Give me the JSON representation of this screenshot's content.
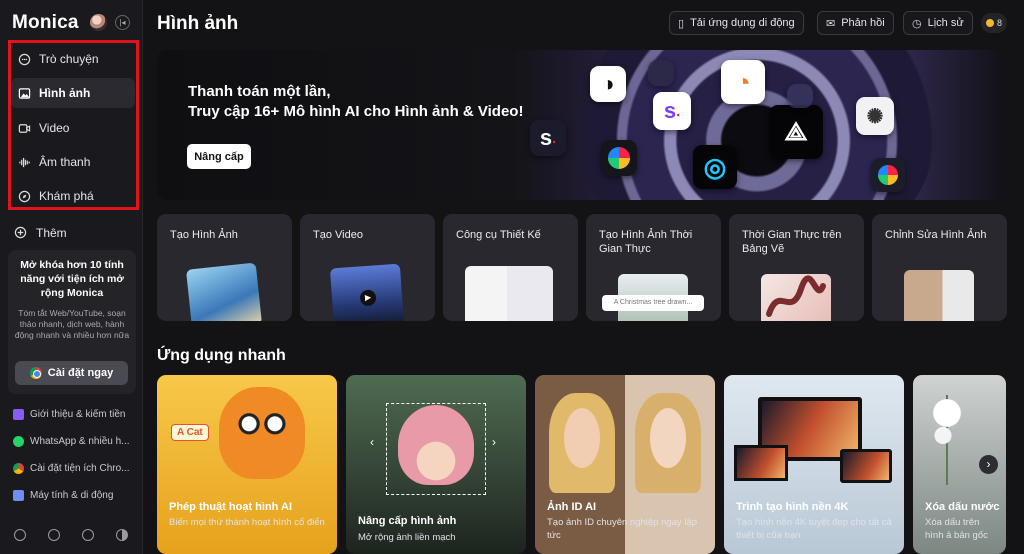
{
  "sidebar": {
    "brand": "Monica",
    "nav": [
      {
        "label": "Trò chuyện",
        "icon": "chat-bubble-icon"
      },
      {
        "label": "Hình ảnh",
        "icon": "image-icon"
      },
      {
        "label": "Video",
        "icon": "video-icon"
      },
      {
        "label": "Âm thanh",
        "icon": "audio-wave-icon"
      },
      {
        "label": "Khám phá",
        "icon": "compass-icon"
      }
    ],
    "more": "Thêm",
    "promo": {
      "title": "Mở khóa hơn 10 tính năng với tiện ích mở rộng Monica",
      "desc": "Tóm tắt Web/YouTube, soạn thảo nhanh, dịch web, hành động nhanh và nhiều hơn nữa",
      "button": "Cài đặt ngay"
    },
    "links": [
      "Giới thiệu & kiếm tiền",
      "WhatsApp & nhiều h...",
      "Cài đặt tiện ích Chro...",
      "Máy tính & di động"
    ]
  },
  "header": {
    "title": "Hình ảnh",
    "buttons": [
      "Tải ứng dụng di động",
      "Phản hồi",
      "Lịch sử"
    ],
    "credits": "8"
  },
  "banner": {
    "line1": "Thanh toán một lần,",
    "line2": "Truy cập 16+ Mô hình AI cho Hình ảnh & Video!",
    "button": "Nâng cấp"
  },
  "features": [
    "Tạo Hình Ảnh",
    "Tạo Video",
    "Công cụ Thiết Kế",
    "Tạo Hình Ảnh Thời Gian Thực",
    "Thời Gian Thực trên Bảng Vẽ",
    "Chỉnh Sửa Hình Ảnh"
  ],
  "feature_caption": "A Christmas tree drawn...",
  "quick_title": "Ứng dụng nhanh",
  "quick_apps": [
    {
      "title": "Phép thuật hoạt hình AI",
      "desc": "Biến mọi thứ thành hoạt hình cổ điển",
      "tag": "A Cat"
    },
    {
      "title": "Nâng cấp hình ảnh",
      "desc": "Mở rộng ảnh liền mạch"
    },
    {
      "title": "Ảnh ID AI",
      "desc": "Tạo ảnh ID chuyên nghiệp ngay lập tức"
    },
    {
      "title": "Trình tạo hình nền 4K",
      "desc": "Tạo hình nền 4K tuyệt đẹp cho tất cả thiết bị của bạn"
    },
    {
      "title": "Xóa dấu nước",
      "desc": "Xóa dấu trên hình ả bản gốc"
    }
  ],
  "colors": {
    "highlight_border": "#e0141b",
    "accent_yellow": "#f3b62c"
  }
}
